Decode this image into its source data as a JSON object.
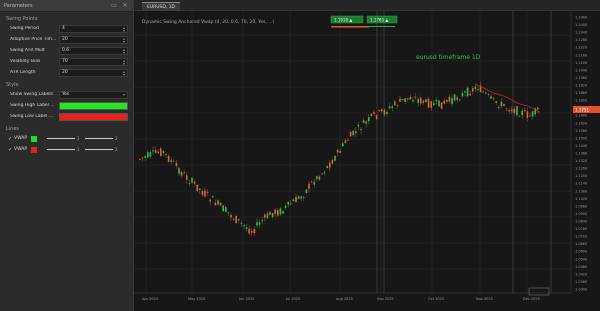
{
  "panel": {
    "title": "Parameters",
    "sections": {
      "swing_points": "Swing Points",
      "style": "Style",
      "lines": "Lines"
    },
    "params": [
      {
        "label": "Swing Period",
        "value": "4"
      },
      {
        "label": "Adaptive Price Tim...",
        "value": "20"
      },
      {
        "label": "Swing ATR Mult",
        "value": "0.6"
      },
      {
        "label": "Volatility Bias",
        "value": "70"
      },
      {
        "label": "ATR Length",
        "value": "20"
      }
    ],
    "style": {
      "show_swing_labels_label": "Show Swing Labels",
      "show_swing_labels_value": "Yes",
      "swing_high_label_color_label": "Swing High Label ...",
      "swing_high_color": "#22e822",
      "swing_low_label_color_label": "Swing Low Label ...",
      "swing_low_color": "#e82020"
    },
    "lines": [
      {
        "name": "VWAP",
        "color": "#22dd22",
        "width": "1",
        "style": "2"
      },
      {
        "name": "VWAP",
        "color": "#dd2222",
        "width": "1",
        "style": "2"
      }
    ]
  },
  "tabs": [
    {
      "label": "EURUSD, 1D"
    }
  ],
  "chart": {
    "legend_text": "Dynamic Swing Anchored Vwap (4, 20, 0.6, 70, 20, Yes, ...)",
    "watermark": "eurusd timeframe 1D",
    "y_ticks": [
      "1.2460",
      "1.2400",
      "1.2340",
      "1.2280",
      "1.2220",
      "1.2160",
      "1.2100",
      "1.2040",
      "1.1980",
      "1.1920",
      "1.1860",
      "1.1800",
      "1.1740",
      "1.1680",
      "1.1620",
      "1.1560",
      "1.1500",
      "1.1440",
      "1.1380",
      "1.1320",
      "1.1260",
      "1.1200",
      "1.1140",
      "1.1080",
      "1.1020",
      "1.0960",
      "1.0900",
      "1.0840",
      "1.0780",
      "1.0720",
      "1.0660",
      "1.0600",
      "1.0540",
      "1.0480",
      "1.0420",
      "1.0360",
      "1.0300"
    ],
    "x_ticks": [
      "Apr 2025",
      "May 2025",
      "Jun 2025",
      "Jul 2025",
      "Aug 2025",
      "Sep 2025",
      "Oct 2025",
      "Nov 2025",
      "Dec 2025"
    ],
    "price_tag": "1.1751",
    "markers": [
      {
        "label": "1.1918 ▲"
      },
      {
        "label": "1.1765 ▲"
      }
    ]
  }
}
